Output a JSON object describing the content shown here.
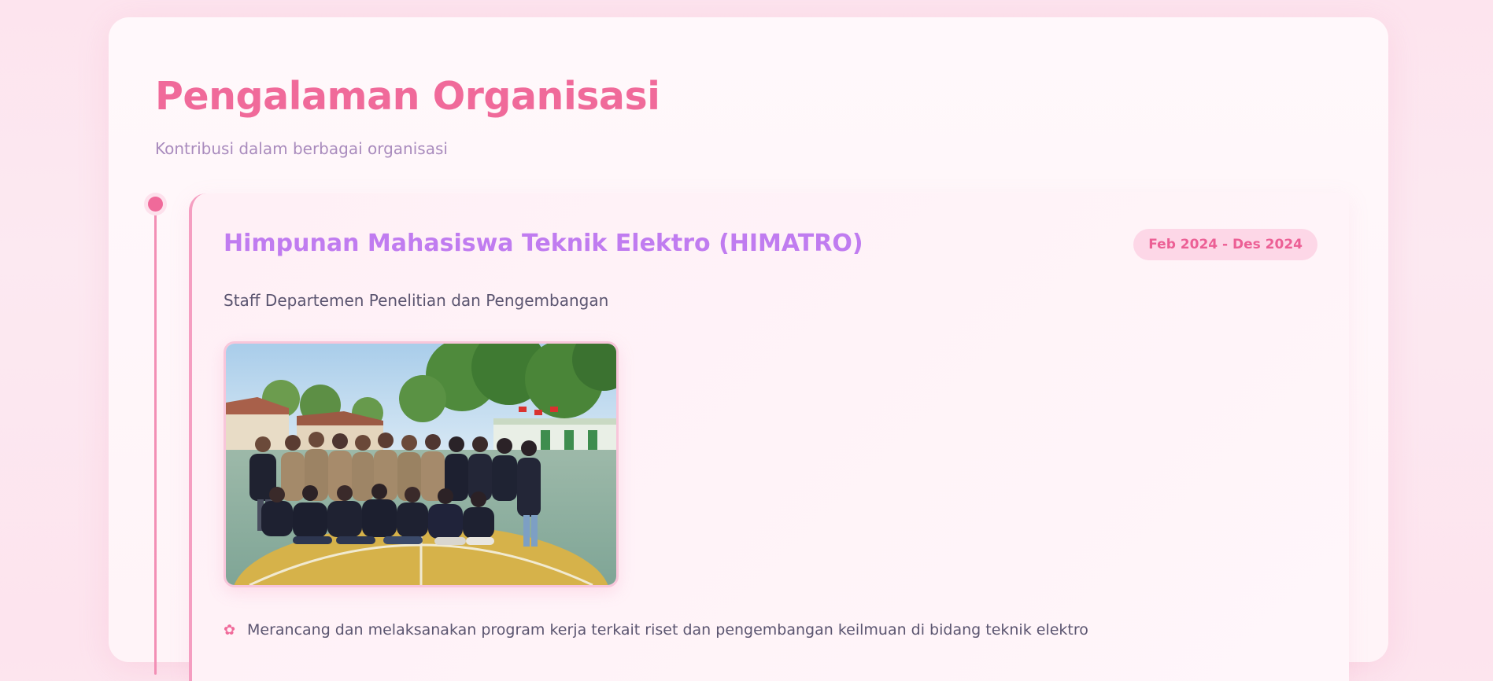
{
  "section": {
    "title": "Pengalaman Organisasi",
    "subtitle": "Kontribusi dalam berbagai organisasi"
  },
  "experience": {
    "organization": "Himpunan Mahasiswa Teknik Elektro (HIMATRO)",
    "date_range": "Feb 2024 - Des 2024",
    "role": "Staff Departemen Penelitian dan Pengembangan",
    "photo_icon": "group-photo",
    "bullets": [
      {
        "icon": "flower-icon",
        "text": "Merancang dan melaksanakan program kerja terkait riset dan pengembangan keilmuan di bidang teknik elektro"
      }
    ]
  },
  "colors": {
    "accent": "#f06a9a",
    "org_name": "#c07cf0",
    "badge_bg": "#fdd7e7",
    "subtitle": "#a98bbd",
    "body_text": "#5b5570"
  }
}
